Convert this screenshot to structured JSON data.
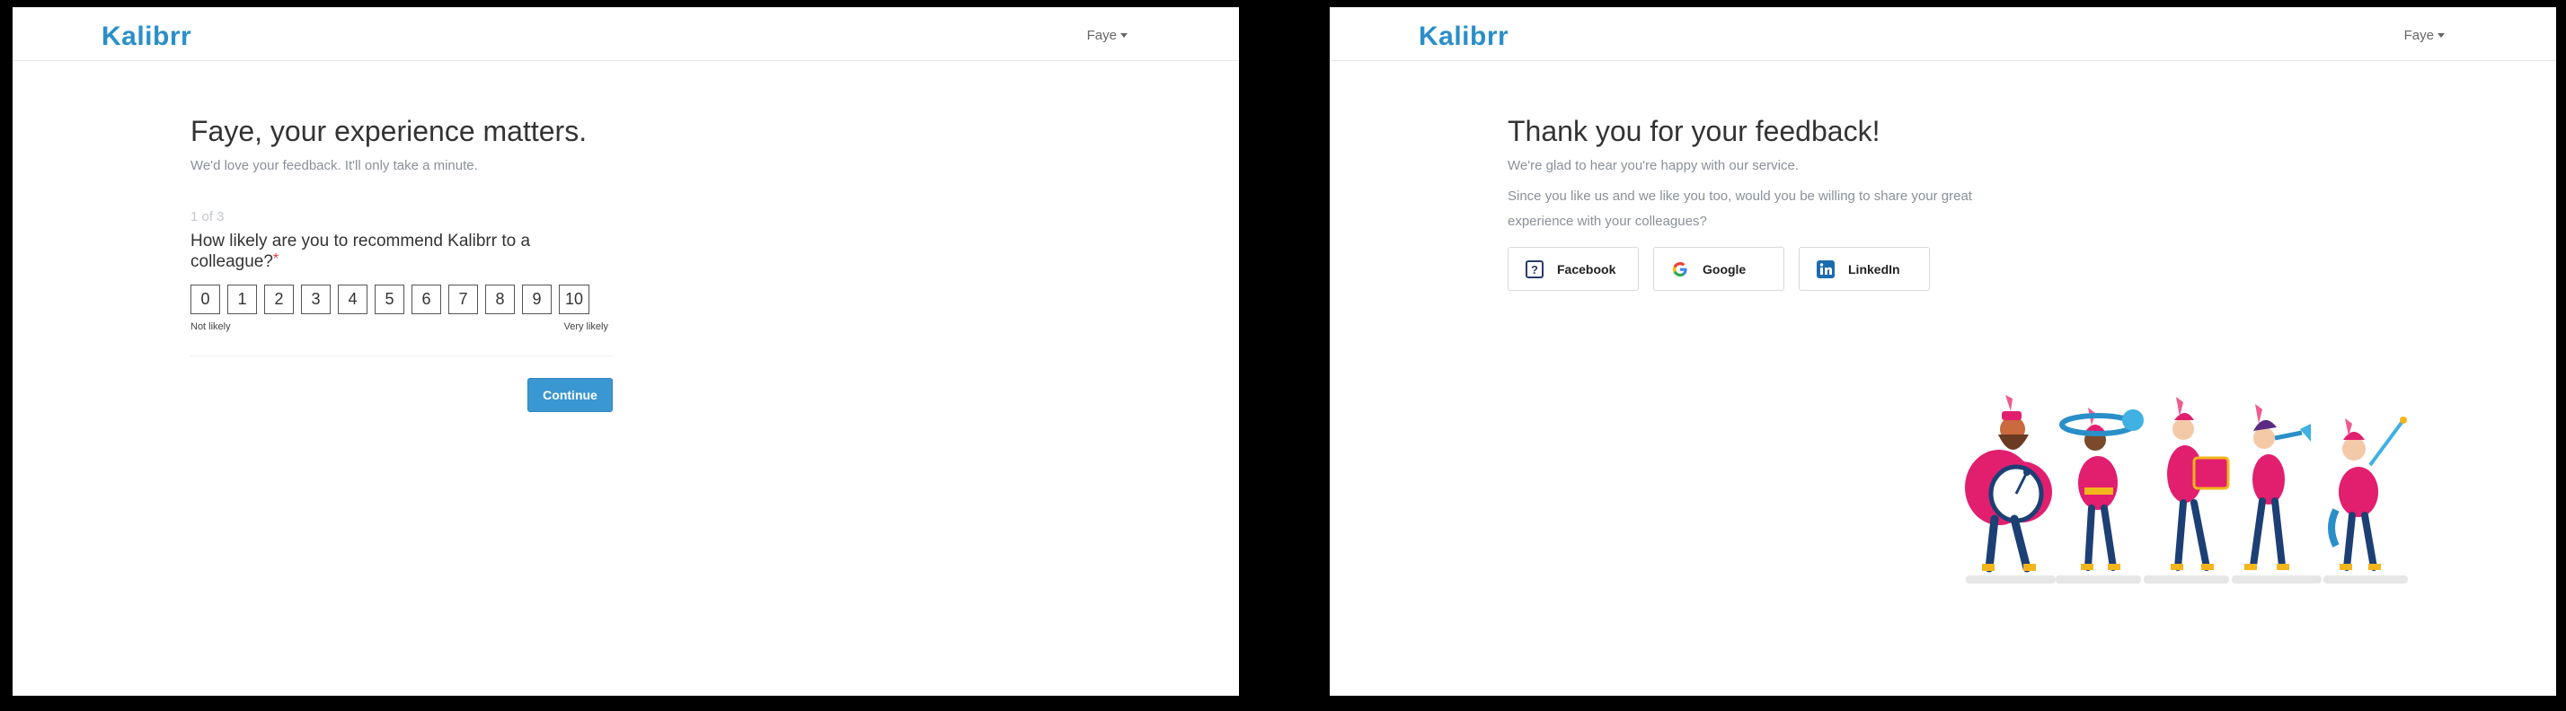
{
  "brand": {
    "name": "Kalibrr",
    "color": "#2a8fc9"
  },
  "user": {
    "name": "Faye"
  },
  "survey": {
    "title": "Faye, your experience matters.",
    "subtitle": "We'd love your feedback. It'll only take a minute.",
    "step": "1 of 3",
    "question": "How likely are you to recommend Kalibrr to a colleague?",
    "required_mark": "*",
    "scale": [
      "0",
      "1",
      "2",
      "3",
      "4",
      "5",
      "6",
      "7",
      "8",
      "9",
      "10"
    ],
    "low_label": "Not likely",
    "high_label": "Very likely",
    "continue_label": "Continue"
  },
  "thanks": {
    "title": "Thank you for your feedback!",
    "line1": "We're glad to hear you're happy with our service.",
    "line2": "Since you like us and we like you too, would you be willing to share your great experience with your colleagues?",
    "buttons": [
      {
        "label": "Facebook",
        "icon": "facebook-icon"
      },
      {
        "label": "Google",
        "icon": "google-icon"
      },
      {
        "label": "LinkedIn",
        "icon": "linkedin-icon"
      }
    ]
  },
  "colors": {
    "accent": "#3a97d2",
    "required": "#e0373b",
    "muted": "#8a9099"
  }
}
